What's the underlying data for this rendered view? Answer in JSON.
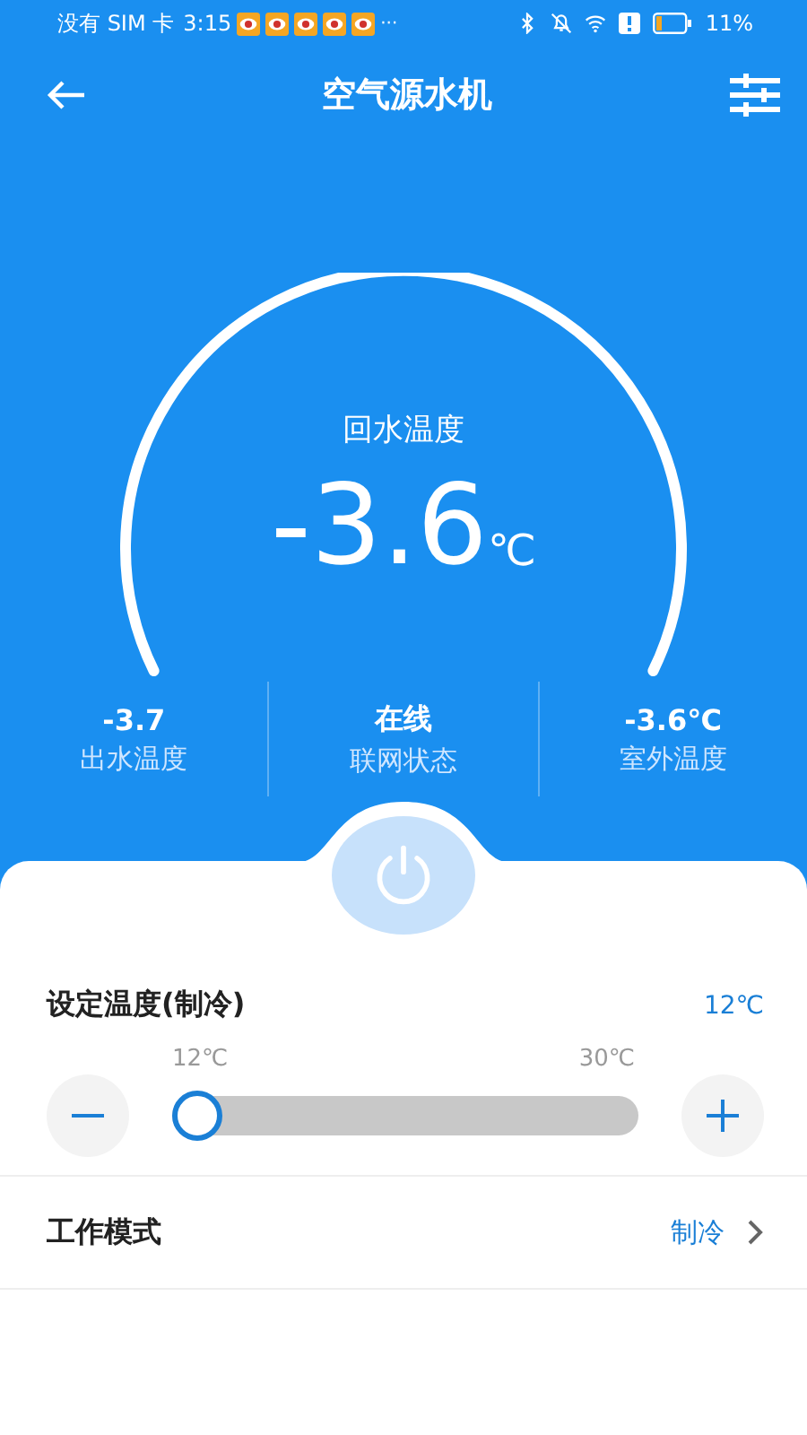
{
  "status_bar": {
    "carrier": "没有 SIM 卡",
    "time": "3:15",
    "more": "···",
    "battery_text": "11%"
  },
  "header": {
    "title": "空气源水机"
  },
  "gauge": {
    "label": "回水温度",
    "value": "-3.6",
    "unit": "℃"
  },
  "stats": [
    {
      "value": "-3.7",
      "label": "出水温度"
    },
    {
      "value": "在线",
      "label": "联网状态"
    },
    {
      "value": "-3.6℃",
      "label": "室外温度"
    }
  ],
  "power": {
    "on": false
  },
  "set_temp": {
    "title": "设定温度(制冷)",
    "value": "12℃",
    "min_label": "12℃",
    "max_label": "30℃",
    "level": 0
  },
  "mode": {
    "title": "工作模式",
    "value": "制冷"
  }
}
